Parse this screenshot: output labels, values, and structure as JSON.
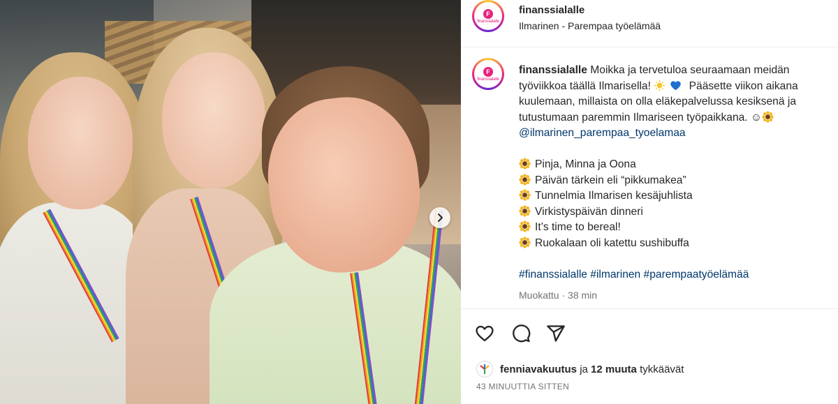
{
  "post": {
    "username": "finanssialalle",
    "subtitle": "Ilmarinen - Parempaa työelämää",
    "avatar_letter": "F",
    "avatar_text": "finanssialalle"
  },
  "caption": {
    "username": "finanssialalle",
    "text_line1": "Moikka ja tervetuloa seuraamaan meidän",
    "text_line2a": "työviikkoa täällä Ilmarisella!",
    "text_line2b": "Pääsette viikon aikana",
    "text_line3": "kuulemaan, millaista on olla eläkepalvelussa kesiksenä ja",
    "text_line4": "tutustumaan paremmin Ilmariseen työpaikkana.",
    "mention": "@ilmarinen_parempaa_tyoelamaa",
    "list": [
      "Pinja, Minna ja Oona",
      "Päivän tärkein eli “pikkumakea”",
      "Tunnelmia Ilmarisen kesäjuhlista",
      "Virkistyspäivän dinneri",
      "It’s time to bereal!",
      "Ruokalaan oli katettu sushibuffa"
    ],
    "hashtags": "#finanssialalle #ilmarinen #parempaatyöelämää",
    "meta": "Muokattu · 38 min"
  },
  "likes": {
    "user": "fenniavakuutus",
    "connector": " ja ",
    "others": "12 muuta",
    "suffix": " tykkäävät"
  },
  "timestamp": "43 MINUUTTIA SITTEN",
  "icons": {
    "like": "heart-icon",
    "comment": "comment-icon",
    "share": "send-icon",
    "next": "chevron-right-icon",
    "flower": "sunflower-emoji"
  },
  "colors": {
    "brand_pink": "#e7227d",
    "link": "#00376b",
    "muted": "#737373",
    "text": "#262626"
  }
}
